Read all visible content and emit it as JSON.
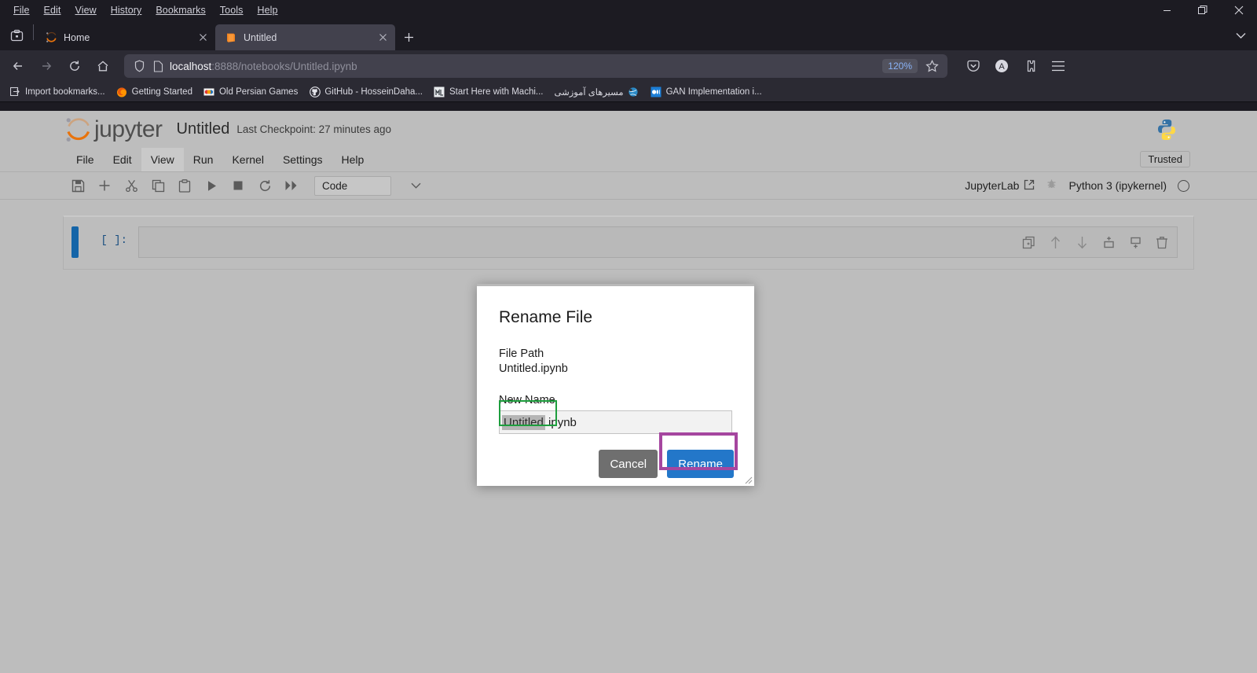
{
  "browser": {
    "menubar": [
      "File",
      "Edit",
      "View",
      "History",
      "Bookmarks",
      "Tools",
      "Help"
    ],
    "window_controls": {
      "minimize": "minimize-icon",
      "restore": "restore-icon",
      "close": "close-icon",
      "tab_list": "chevron-down-icon"
    },
    "tabs": [
      {
        "label": "Home",
        "favicon": "jupyter-icon",
        "active": false
      },
      {
        "label": "Untitled",
        "favicon": "notebook-icon",
        "active": true
      }
    ],
    "new_tab_label": "+",
    "nav": {
      "back": "back-arrow-icon",
      "forward": "forward-arrow-icon",
      "reload": "reload-icon",
      "home": "home-icon"
    },
    "urlbar": {
      "shield": "shield-icon",
      "page_icon": "page-icon",
      "host": "localhost",
      "path": ":8888/notebooks/Untitled.ipynb",
      "zoom_level": "120%",
      "bookmark_star": "star-icon"
    },
    "toolbar_right": [
      "pocket-icon",
      "account-icon",
      "extensions-icon",
      "app-menu-icon"
    ],
    "account_initial": "A",
    "bookmarks": [
      {
        "label": "Import bookmarks...",
        "icon": "import-icon"
      },
      {
        "label": "Getting Started",
        "icon": "firefox-icon"
      },
      {
        "label": "Old Persian Games",
        "icon": "game-icon"
      },
      {
        "label": "GitHub - HosseinDaha...",
        "icon": "github-icon"
      },
      {
        "label": "Start Here with Machi...",
        "icon": "machinelearning-icon"
      },
      {
        "label": "مسیرهای آموزشی",
        "icon": "globe-icon"
      },
      {
        "label": "GAN Implementation i...",
        "icon": "medium-icon"
      }
    ]
  },
  "jupyter": {
    "brand": "jupyter",
    "notebook_title": "Untitled",
    "checkpoint": "Last Checkpoint: 27 minutes ago",
    "menu": [
      "File",
      "Edit",
      "View",
      "Run",
      "Kernel",
      "Settings",
      "Help"
    ],
    "active_menu": "View",
    "trusted_label": "Trusted",
    "toolbar": {
      "buttons": [
        "save-icon",
        "insert-cell-icon",
        "cut-icon",
        "copy-icon",
        "paste-icon",
        "run-icon",
        "stop-icon",
        "restart-icon",
        "run-all-icon"
      ],
      "cell_type": "Code",
      "cell_type_caret": "chevron-down-icon",
      "jupyterlab_label": "JupyterLab",
      "jupyterlab_icon": "external-link-icon",
      "debug_icon": "bug-icon",
      "kernel_name": "Python 3 (ipykernel)",
      "kernel_status": "idle-circle-icon"
    },
    "cell": {
      "prompt": "[ ]:",
      "content": "",
      "tools": [
        "duplicate-icon",
        "move-up-icon",
        "move-down-icon",
        "insert-above-icon",
        "insert-below-icon",
        "delete-icon"
      ]
    }
  },
  "dialog": {
    "title": "Rename File",
    "file_path_label": "File Path",
    "file_path_value": "Untitled.ipynb",
    "new_name_label": "New Name",
    "new_name_selected": "Untitled",
    "new_name_rest": ".ipynb",
    "cancel_label": "Cancel",
    "rename_label": "Rename",
    "resize_handle": "resize-handle-icon"
  },
  "annotations": {
    "green_box_color": "#1e9e3e",
    "magenta_box_color": "#a5469f"
  }
}
